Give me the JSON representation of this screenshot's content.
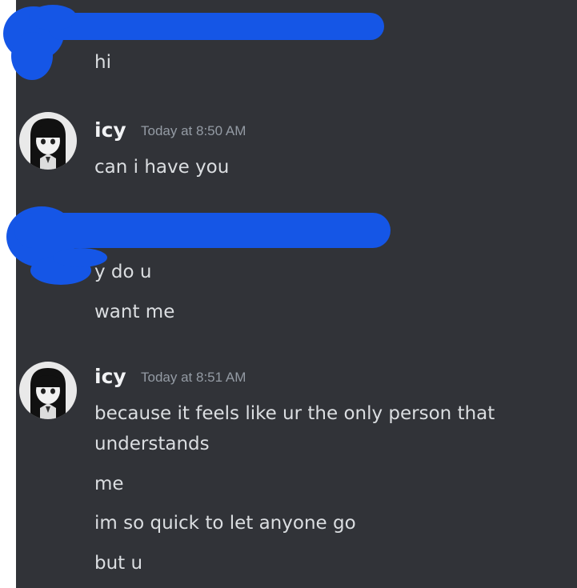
{
  "messages": [
    {
      "group": "redacted-user-1",
      "lines": [
        "hi"
      ]
    },
    {
      "group": "icy-1",
      "author": "icy",
      "timestamp": "Today at 8:50 AM",
      "avatar_icon": "anime-girl-avatar",
      "lines": [
        "can i have you"
      ]
    },
    {
      "group": "redacted-user-2",
      "lines": [
        "y do u",
        "want me"
      ]
    },
    {
      "group": "icy-2",
      "author": "icy",
      "timestamp": "Today at 8:51 AM",
      "avatar_icon": "anime-girl-avatar",
      "lines": [
        "because it feels like ur the only person that",
        "understands",
        "me",
        "im so quick to let anyone go",
        "but u"
      ]
    }
  ],
  "colors": {
    "background": "#313338",
    "text": "#dbdee1",
    "author": "#f2f3f5",
    "timestamp": "#949ba4",
    "redaction": "#1556e6"
  }
}
